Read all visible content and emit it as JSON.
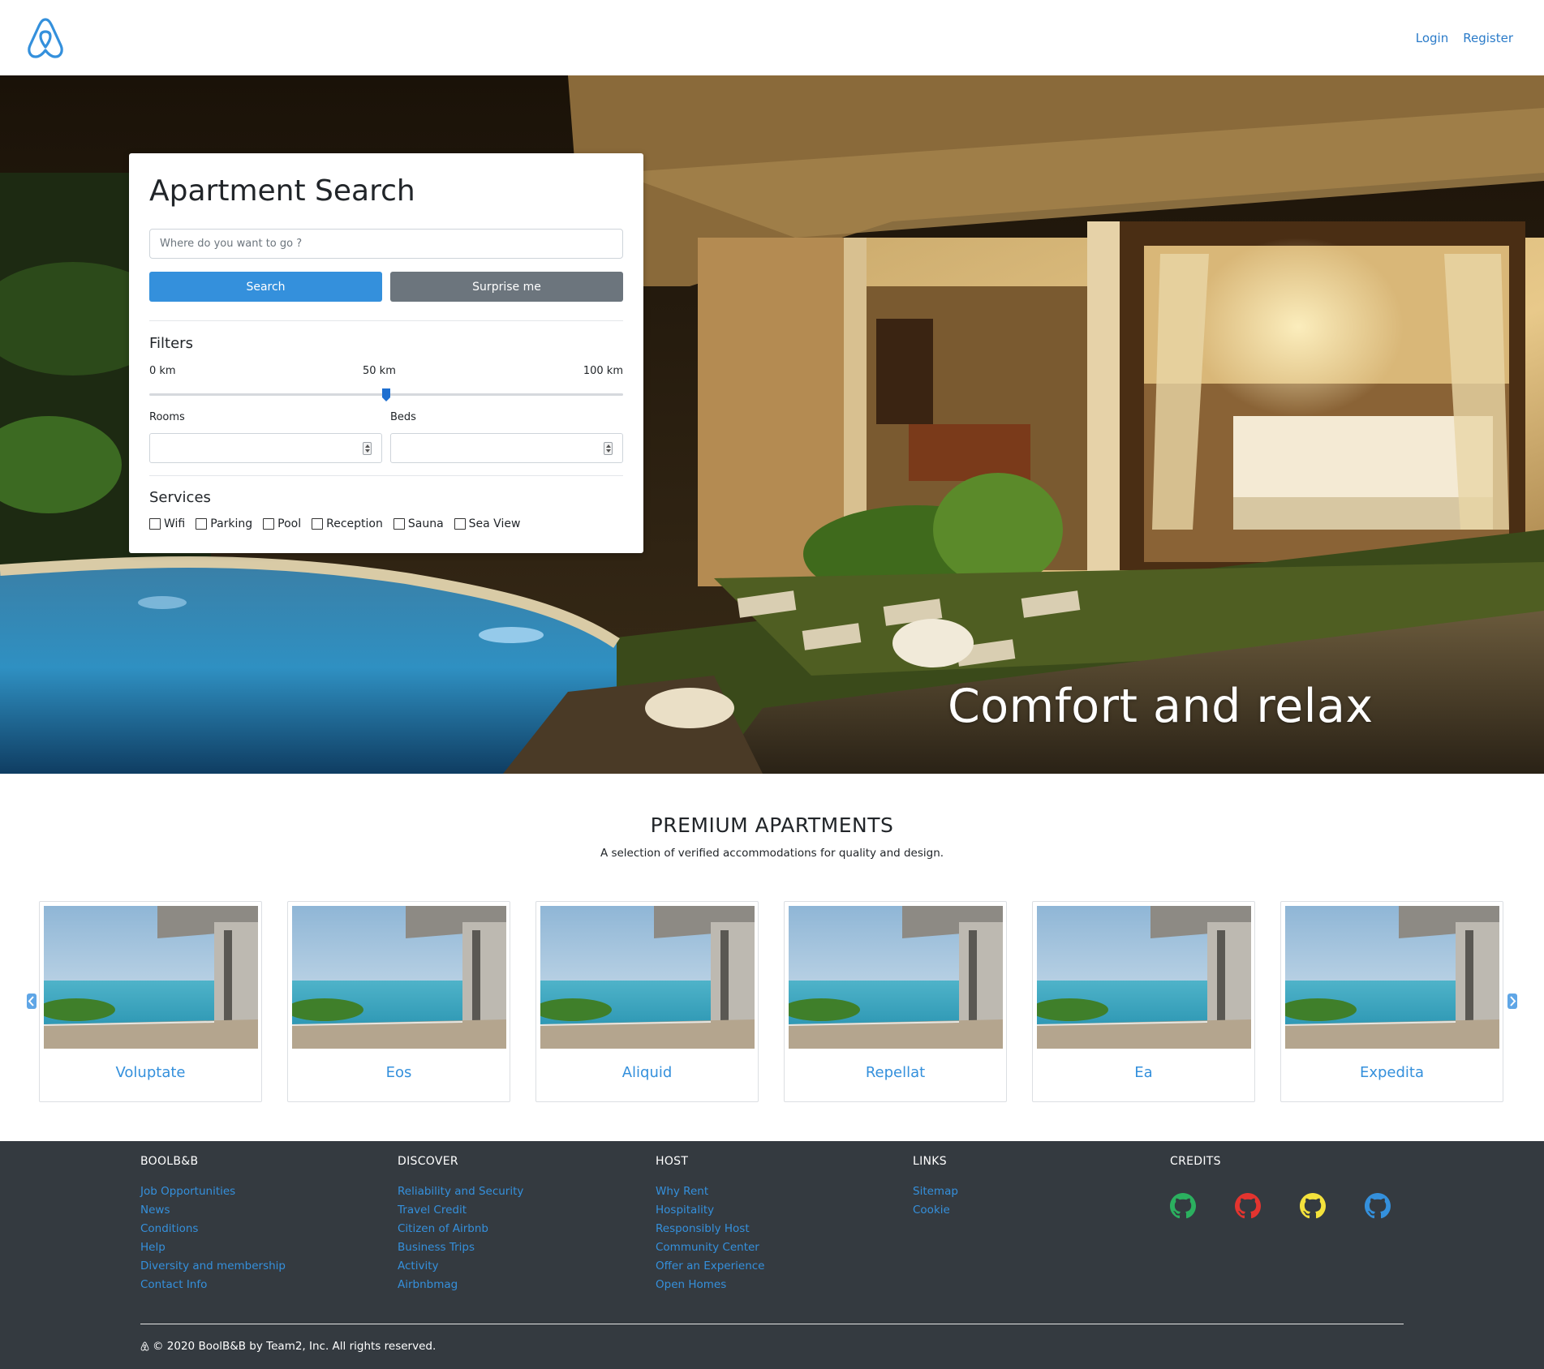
{
  "header": {
    "login": "Login",
    "register": "Register"
  },
  "hero": {
    "caption": "Comfort and relax"
  },
  "search": {
    "title": "Apartment Search",
    "placeholder": "Where do you want to go ?",
    "search_label": "Search",
    "surprise_label": "Surprise me",
    "filters_title": "Filters",
    "range_min": "0 km",
    "range_mid": "50 km",
    "range_max": "100 km",
    "range_value_fraction": 0.5,
    "rooms_label": "Rooms",
    "beds_label": "Beds",
    "services_title": "Services",
    "services": [
      "Wifi",
      "Parking",
      "Pool",
      "Reception",
      "Sauna",
      "Sea View"
    ]
  },
  "premium": {
    "title": "PREMIUM APARTMENTS",
    "subtitle": "A selection of verified accommodations for quality and design.",
    "apartments": [
      "Voluptate",
      "Eos",
      "Aliquid",
      "Repellat",
      "Ea",
      "Expedita"
    ]
  },
  "footer": {
    "columns": [
      {
        "title": "BOOLB&B",
        "links": [
          "Job Opportunities",
          "News",
          "Conditions",
          "Help",
          "Diversity and membership",
          "Contact Info"
        ]
      },
      {
        "title": "DISCOVER",
        "links": [
          "Reliability and Security",
          "Travel Credit",
          "Citizen of Airbnb",
          "Business Trips",
          "Activity",
          "Airbnbmag"
        ]
      },
      {
        "title": "HOST",
        "links": [
          "Why Rent",
          "Hospitality",
          "Responsibly Host",
          "Community Center",
          "Offer an Experience",
          "Open Homes"
        ]
      },
      {
        "title": "LINKS",
        "links": [
          "Sitemap",
          "Cookie"
        ]
      },
      {
        "title": "CREDITS",
        "links": []
      }
    ],
    "credit_colors": [
      "#2bb05f",
      "#e3342f",
      "#f4e23c",
      "#3490dc"
    ],
    "copyright": "© 2020 BoolB&B by Team2, Inc. All rights reserved."
  },
  "colors": {
    "brand_blue": "#3490dc",
    "secondary_gray": "#6c757d",
    "footer_bg": "#343a40"
  }
}
